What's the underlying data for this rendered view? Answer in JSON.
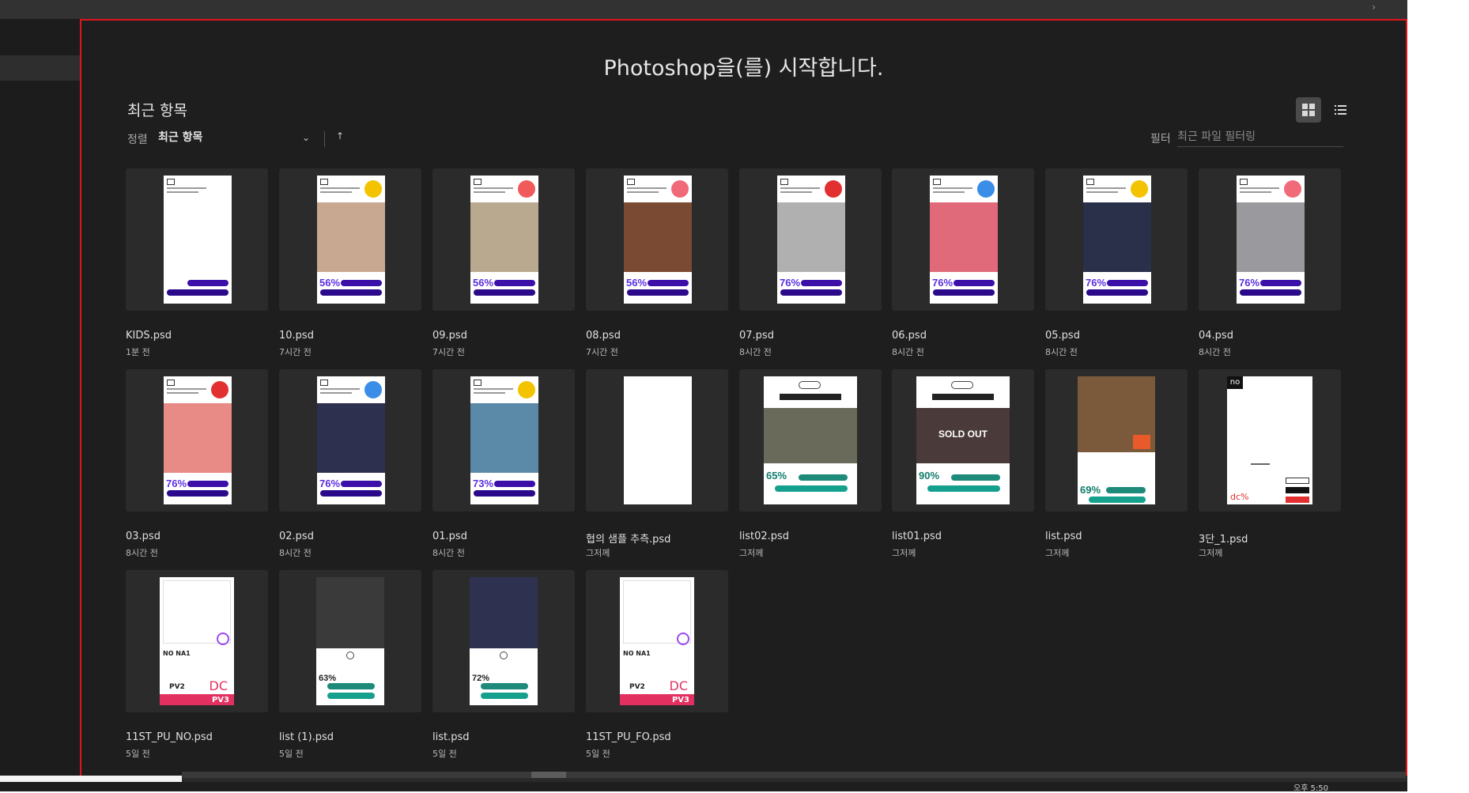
{
  "topbar": {
    "corner_glyph": "›"
  },
  "home": {
    "title": "Photoshop을(를) 시작합니다.",
    "recent_title": "최근 항목",
    "sort": {
      "label": "정렬",
      "value": "최근 항목",
      "chevron": "⌄",
      "direction": "↑"
    },
    "filter": {
      "label": "필터",
      "placeholder": "최근 파일 필터링",
      "value": ""
    },
    "view": {
      "active": "grid"
    }
  },
  "files": [
    {
      "name": "KIDS.psd",
      "time": "1분 전",
      "thumb": "kids"
    },
    {
      "name": "10.psd",
      "time": "7시간 전",
      "thumb": "promo",
      "pct": "56%",
      "badge": "#f3c300",
      "photo": "#c9a892"
    },
    {
      "name": "09.psd",
      "time": "7시간 전",
      "thumb": "promo",
      "pct": "56%",
      "badge": "#f05a5a",
      "photo": "#b8a98f"
    },
    {
      "name": "08.psd",
      "time": "7시간 전",
      "thumb": "promo",
      "pct": "56%",
      "badge": "#f06a7a",
      "photo": "#7a4a32"
    },
    {
      "name": "07.psd",
      "time": "8시간 전",
      "thumb": "promo",
      "pct": "76%",
      "badge": "#e23030",
      "photo": "#b0b0b0"
    },
    {
      "name": "06.psd",
      "time": "8시간 전",
      "thumb": "promo",
      "pct": "76%",
      "badge": "#3a8ee8",
      "photo": "#e06a7a"
    },
    {
      "name": "05.psd",
      "time": "8시간 전",
      "thumb": "promo",
      "pct": "76%",
      "badge": "#f3c300",
      "photo": "#2a2f4a"
    },
    {
      "name": "04.psd",
      "time": "8시간 전",
      "thumb": "promo",
      "pct": "76%",
      "badge": "#f06a7a",
      "photo": "#9a9a9e"
    },
    {
      "name": "03.psd",
      "time": "8시간 전",
      "thumb": "promo",
      "pct": "76%",
      "badge": "#e23030",
      "photo": "#e88a86"
    },
    {
      "name": "02.psd",
      "time": "8시간 전",
      "thumb": "promo",
      "pct": "76%",
      "badge": "#3a8ee8",
      "photo": "#2e3050"
    },
    {
      "name": "01.psd",
      "time": "8시간 전",
      "thumb": "promo",
      "pct": "73%",
      "badge": "#f3c300",
      "photo": "#5a8aa8"
    },
    {
      "name": "협의 샘플 추측.psd",
      "time": "그저께",
      "thumb": "blank"
    },
    {
      "name": "list02.psd",
      "time": "그저께",
      "thumb": "list",
      "pct": "65%",
      "photo": "#6a6a5a",
      "title_color": "#1a1a1a"
    },
    {
      "name": "list01.psd",
      "time": "그저께",
      "thumb": "soldout",
      "pct": "90%",
      "photo": "#4a3a3a",
      "sold_label": "SOLD OUT"
    },
    {
      "name": "list.psd",
      "time": "그저께",
      "thumb": "tall",
      "pct": "69%",
      "photo": "#7a5a3a"
    },
    {
      "name": "3단_1.psd",
      "time": "그저께",
      "thumb": "three",
      "tag": "no",
      "dc": "dc%"
    },
    {
      "name": "11ST_PU_NO.psd",
      "time": "5일 전",
      "thumb": "pv",
      "no_label": "NO  NA1",
      "pv": "PV2",
      "dc": "DC",
      "pv3": "PV3"
    },
    {
      "name": "list (1).psd",
      "time": "5일 전",
      "thumb": "list2",
      "pct": "63%",
      "photo": "#3a3a3a"
    },
    {
      "name": "list.psd",
      "time": "5일 전",
      "thumb": "list3",
      "pct": "72%",
      "photo": "#2e3250"
    },
    {
      "name": "11ST_PU_FO.psd",
      "time": "5일 전",
      "thumb": "pv",
      "no_label": "NO  NA1",
      "pv": "PV2",
      "dc": "DC",
      "pv3": "PV3"
    }
  ],
  "footer": {
    "text": "오후 5:50"
  }
}
